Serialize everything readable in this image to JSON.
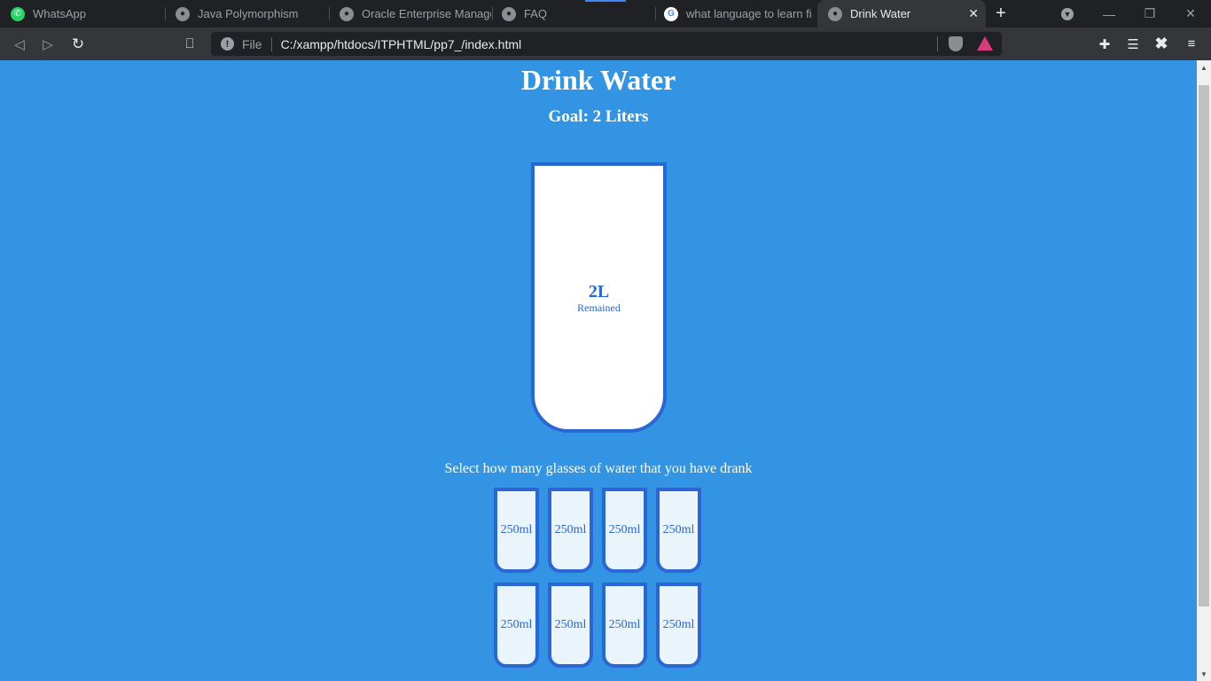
{
  "browser": {
    "tabs": [
      {
        "title": "WhatsApp",
        "icon": "whatsapp-icon"
      },
      {
        "title": "Java Polymorphism",
        "icon": "globe-icon"
      },
      {
        "title": "Oracle Enterprise Manager",
        "icon": "globe-icon"
      },
      {
        "title": "FAQ",
        "icon": "globe-icon"
      },
      {
        "title": "what language to learn first",
        "icon": "google-icon"
      },
      {
        "title": "Drink Water",
        "icon": "globe-icon",
        "active": true
      }
    ],
    "omnibox": {
      "scheme_label": "File",
      "url": "C:/xampp/htdocs/ITPHTML/pp7_/index.html"
    }
  },
  "page": {
    "title": "Drink Water",
    "goal": "Goal: 2 Liters",
    "big_cup": {
      "remained_value": "2L",
      "remained_label": "Remained",
      "fill_percent": 0
    },
    "instructions": "Select how many glasses of water that you have drank",
    "cups": [
      {
        "label": "250ml",
        "full": false
      },
      {
        "label": "250ml",
        "full": false
      },
      {
        "label": "250ml",
        "full": false
      },
      {
        "label": "250ml",
        "full": false
      },
      {
        "label": "250ml",
        "full": false
      },
      {
        "label": "250ml",
        "full": false
      },
      {
        "label": "250ml",
        "full": false
      },
      {
        "label": "250ml",
        "full": false
      }
    ]
  },
  "colors": {
    "page_background": "#3494e4",
    "cup_border": "#2a67d4",
    "cup_fill": "#ffffff",
    "small_cup_fill": "#eaf4fb"
  }
}
